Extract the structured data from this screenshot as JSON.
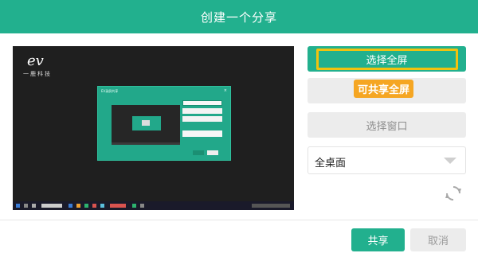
{
  "dialog": {
    "title": "创建一个分享"
  },
  "preview": {
    "logo_mark": "ev",
    "logo_text": "一鹿科技",
    "inner_window_title": "EV录屏共享",
    "inner_window_close": "×"
  },
  "panel": {
    "select_fullscreen_label": "选择全屏",
    "callout_text": "可共享全屏",
    "select_window_label": "选择窗口",
    "desktop_select_value": "全桌面"
  },
  "footer": {
    "share_label": "共享",
    "cancel_label": "取消"
  },
  "colors": {
    "accent": "#22b08e",
    "highlight": "#f1c20f",
    "callout": "#f5a623"
  },
  "icons": [
    "refresh-icon",
    "chevron-down-icon"
  ]
}
